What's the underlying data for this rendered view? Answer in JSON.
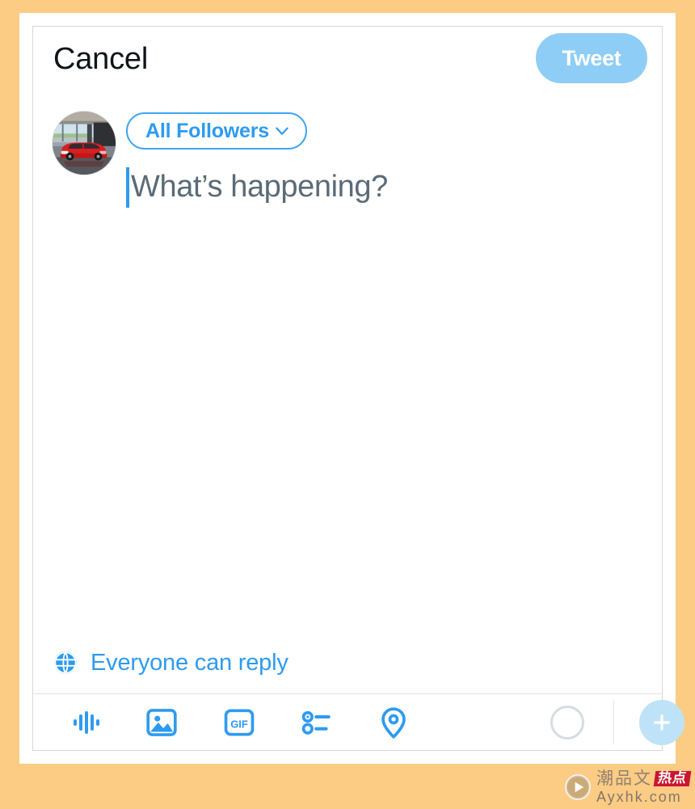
{
  "theme": {
    "page_background": "#FCCB84",
    "card_background": "#FFFFFF",
    "accent_blue": "#2E9BF0",
    "accent_blue_disabled": "#8ECDF5",
    "add_button_blue": "#BEE3F8",
    "placeholder_gray": "#5B6B76",
    "counter_ring_gray": "#D5DDE2",
    "divider_gray": "#E2E2E2",
    "panel_border": "#D8D8D8",
    "watermark_red": "#C8102E"
  },
  "header": {
    "cancel_label": "Cancel",
    "tweet_label": "Tweet",
    "tweet_enabled": false
  },
  "composer": {
    "avatar": {
      "name": "user-avatar",
      "description": "red classic hatchback car in a showroom"
    },
    "audience": {
      "label": "All Followers",
      "chevron_icon": "chevron-down-icon"
    },
    "placeholder": "What’s happening?",
    "value": "",
    "caret_visible": true
  },
  "reply_scope": {
    "icon": "globe-icon",
    "label": "Everyone can reply"
  },
  "toolbar": {
    "items": [
      {
        "name": "audio-icon",
        "label": "Audio"
      },
      {
        "name": "image-icon",
        "label": "Media"
      },
      {
        "name": "gif-icon",
        "label": "GIF"
      },
      {
        "name": "poll-icon",
        "label": "Poll"
      },
      {
        "name": "location-icon",
        "label": "Location"
      }
    ],
    "gif_text": "GIF",
    "char_counter": {
      "name": "character-counter-ring",
      "remaining": "280"
    },
    "add_tweet": {
      "name": "add-tweet-button",
      "icon": "plus-icon"
    }
  },
  "watermark": {
    "play_icon": "play-icon",
    "cn_text": "潮品文",
    "badge_text": "热点",
    "domain": "Ayxhk.com"
  }
}
